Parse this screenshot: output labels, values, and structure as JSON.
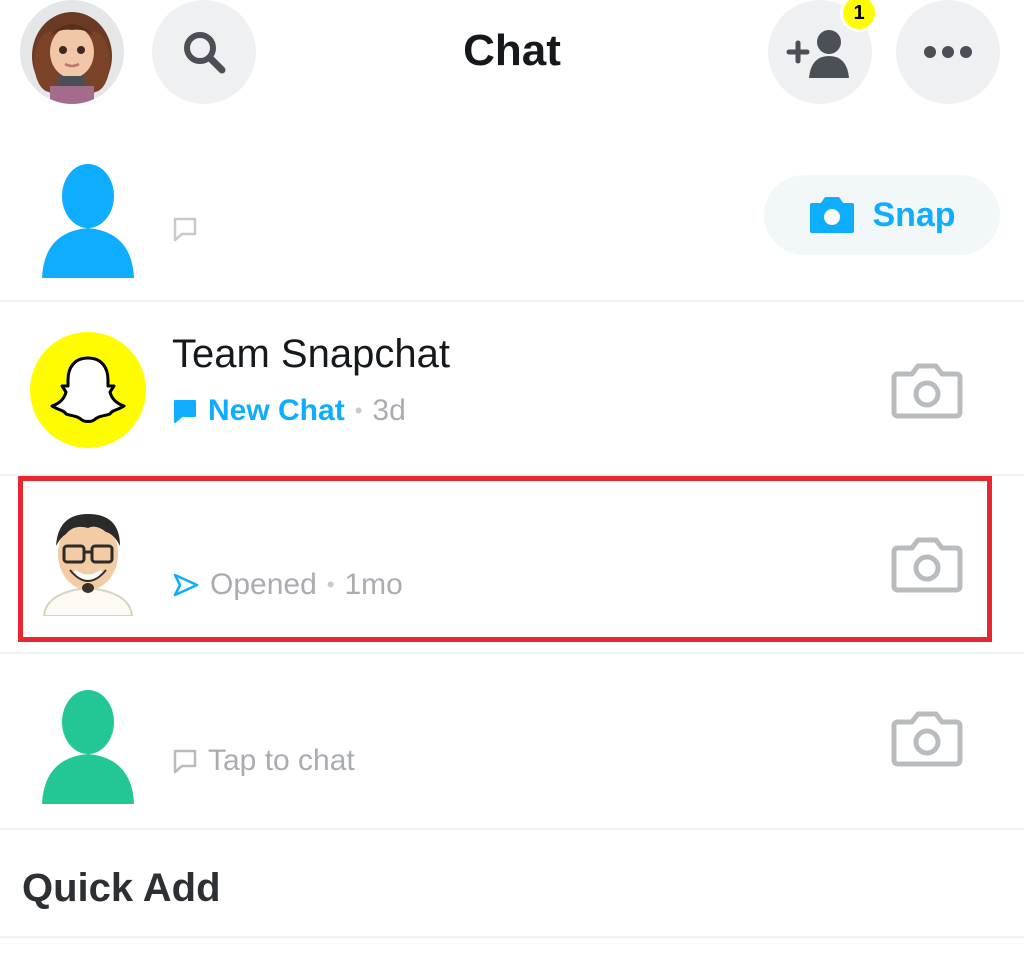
{
  "header": {
    "title": "Chat",
    "friend_request_count": "1",
    "icons": {
      "profile": "bitmoji-avatar",
      "search": "search-icon",
      "add_friend": "add-friend-icon",
      "more": "more-icon"
    }
  },
  "chats": [
    {
      "name": "",
      "status": "",
      "time": "",
      "action": "Snap",
      "avatar": "silhouette",
      "avatar_color": "#0fadff"
    },
    {
      "name": "Team Snapchat",
      "status": "New Chat",
      "time": "3d",
      "avatar": "snapchat-ghost",
      "avatar_color": "#fffc00"
    },
    {
      "name": "",
      "status": "Opened",
      "time": "1mo",
      "avatar": "bitmoji-glasses",
      "highlighted": true
    },
    {
      "name": "",
      "status": "Tap to chat",
      "time": "",
      "avatar": "silhouette",
      "avatar_color": "#23c795"
    }
  ],
  "section": {
    "quick_add": "Quick Add"
  },
  "colors": {
    "accent": "#0fadff",
    "highlight": "#e8282e",
    "snap_yellow": "#fffc00",
    "muted": "#a9acb0"
  }
}
